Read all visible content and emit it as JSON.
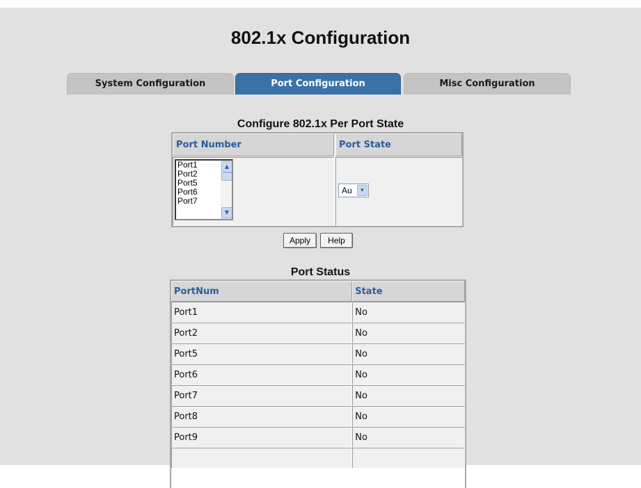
{
  "page": {
    "title": "802.1x Configuration"
  },
  "tabs": [
    {
      "label": "System Configuration",
      "active": false
    },
    {
      "label": "Port Configuration",
      "active": true
    },
    {
      "label": "Misc Configuration",
      "active": false
    }
  ],
  "per_port": {
    "title": "Configure 802.1x Per Port State",
    "col_port_number": "Port Number",
    "col_port_state": "Port State",
    "port_list": [
      "Port1",
      "Port2",
      "Port5",
      "Port6",
      "Port7"
    ],
    "state_select_value": "Au",
    "apply_label": "Apply",
    "help_label": "Help"
  },
  "status": {
    "title": "Port Status",
    "col_portnum": "PortNum",
    "col_state": "State",
    "rows": [
      {
        "port": "Port1",
        "state": "No"
      },
      {
        "port": "Port2",
        "state": "No"
      },
      {
        "port": "Port5",
        "state": "No"
      },
      {
        "port": "Port6",
        "state": "No"
      },
      {
        "port": "Port7",
        "state": "No"
      },
      {
        "port": "Port8",
        "state": "No"
      },
      {
        "port": "Port9",
        "state": "No"
      },
      {
        "port": "",
        "state": ""
      }
    ]
  },
  "colors": {
    "background": "#e1e1e1",
    "tab_active": "#3a72a8",
    "tab_inactive": "#c4c4c4",
    "header_text": "#2a5d9b"
  },
  "icons": {
    "scroll_up": "chevron-up-icon",
    "scroll_down": "chevron-down-icon",
    "select_arrow": "chevron-down-icon"
  }
}
